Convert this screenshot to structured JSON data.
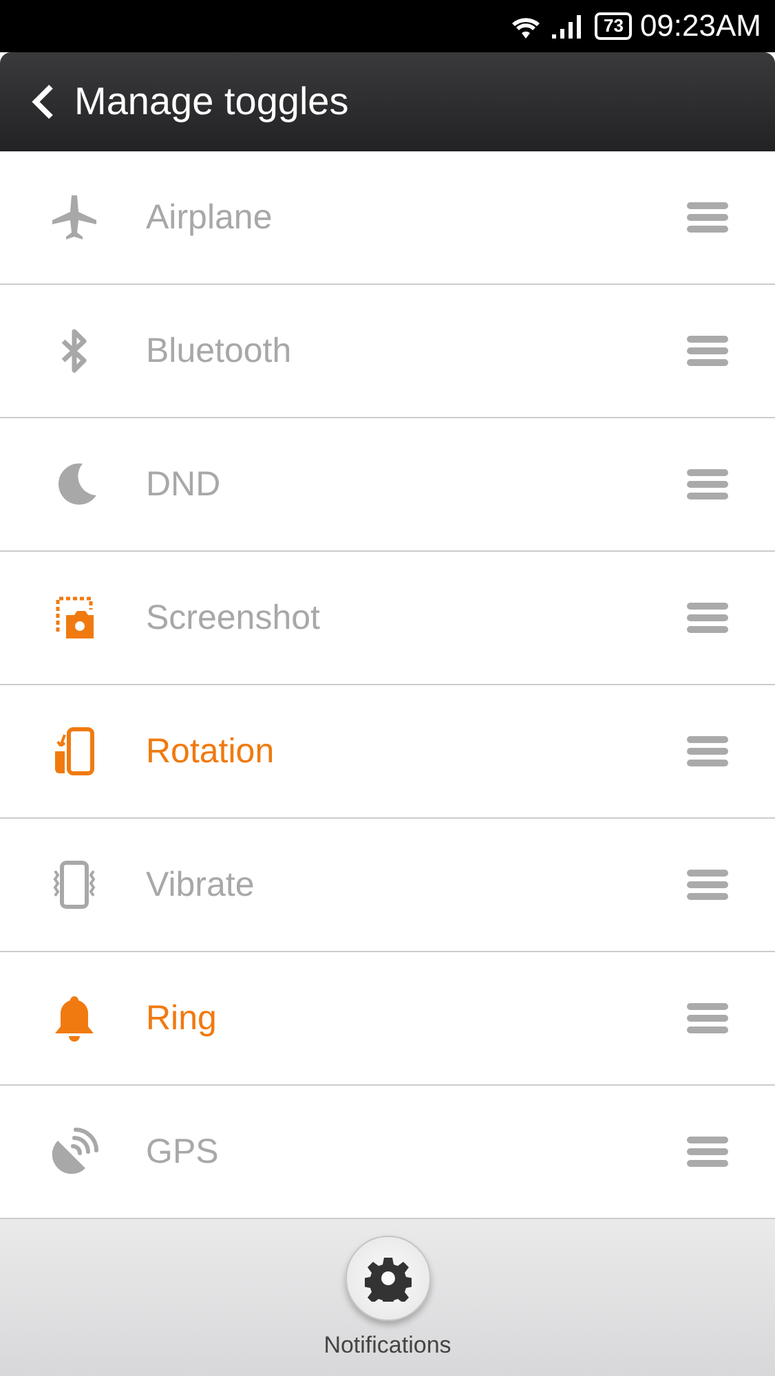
{
  "status_bar": {
    "battery": "73",
    "time": "09:23AM"
  },
  "header": {
    "title": "Manage toggles"
  },
  "toggles": [
    {
      "kind": "airplane",
      "label": "Airplane",
      "on": false
    },
    {
      "kind": "bluetooth",
      "label": "Bluetooth",
      "on": false
    },
    {
      "kind": "dnd",
      "label": "DND",
      "on": false
    },
    {
      "kind": "screenshot",
      "label": "Screenshot",
      "on": false
    },
    {
      "kind": "rotation",
      "label": "Rotation",
      "on": true
    },
    {
      "kind": "vibrate",
      "label": "Vibrate",
      "on": false
    },
    {
      "kind": "ring",
      "label": "Ring",
      "on": true
    },
    {
      "kind": "gps",
      "label": "GPS",
      "on": false
    }
  ],
  "footer": {
    "button": "Notifications"
  }
}
